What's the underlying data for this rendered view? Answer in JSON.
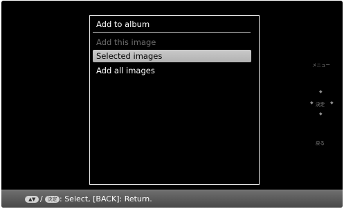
{
  "dialog": {
    "title": "Add to album",
    "items": [
      {
        "label": "Add this image",
        "state": "disabled"
      },
      {
        "label": "Selected images",
        "state": "selected"
      },
      {
        "label": "Add all images",
        "state": "normal"
      }
    ]
  },
  "side_panel": {
    "menu_label": "メニュー",
    "enter_label": "決定",
    "back_label": "戻る"
  },
  "status_bar": {
    "nav_icon": "up-down-arrows-icon",
    "nav_icon_glyph": "▲▼",
    "enter_icon_glyph": "決定",
    "separator": "/",
    "text": ": Select, [BACK]: Return."
  },
  "colors": {
    "screen_bg": "#000000",
    "highlight": "#bdbdbd",
    "disabled_text": "#6c6c6c",
    "status_bar": "#5a5a5a"
  }
}
